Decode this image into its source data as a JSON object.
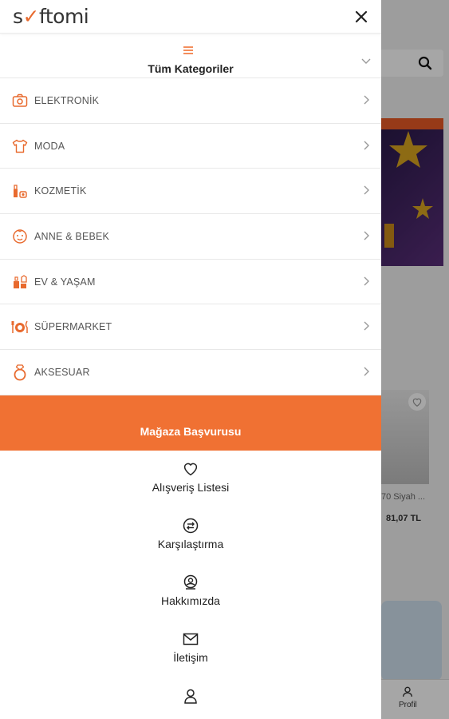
{
  "header": {
    "logo_text_a": "s",
    "logo_text_b": "ftomi",
    "close_icon": "close-icon"
  },
  "background": {
    "product_name": "70 Siyah ...",
    "product_price": "81,07 TL",
    "profile_label": "Profil"
  },
  "all_categories": {
    "label": "Tüm Kategoriler",
    "icon": "menu-icon"
  },
  "categories": [
    {
      "label": "ELEKTRONİK",
      "icon": "camera-icon"
    },
    {
      "label": "MODA",
      "icon": "shirt-icon"
    },
    {
      "label": "KOZMETİK",
      "icon": "cosmetics-icon"
    },
    {
      "label": "ANNE & BEBEK",
      "icon": "baby-icon"
    },
    {
      "label": "EV & YAŞAM",
      "icon": "home-icon"
    },
    {
      "label": "SÜPERMARKET",
      "icon": "dining-icon"
    },
    {
      "label": "AKSESUAR",
      "icon": "ring-icon"
    }
  ],
  "store_application": "Mağaza Başvurusu",
  "links": [
    {
      "label": "Alışveriş Listesi",
      "icon": "heart-icon"
    },
    {
      "label": "Karşılaştırma",
      "icon": "compare-icon"
    },
    {
      "label": "Hakkımızda",
      "icon": "about-icon"
    },
    {
      "label": "İletişim",
      "icon": "mail-icon"
    },
    {
      "label": "",
      "icon": "user-icon"
    }
  ],
  "colors": {
    "accent": "#f07133",
    "icon_orange": "#e86a2e"
  }
}
